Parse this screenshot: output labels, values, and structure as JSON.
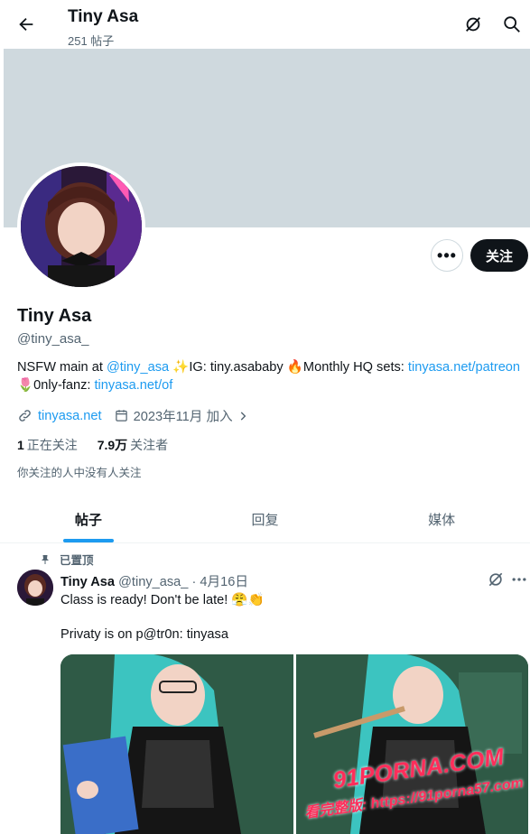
{
  "header": {
    "title": "Tiny Asa",
    "post_count": "251 帖子"
  },
  "profile": {
    "more_label": "•••",
    "follow_label": "关注",
    "name": "Tiny Asa",
    "handle": "@tiny_asa_",
    "bio": {
      "p1": "NSFW main at ",
      "mention": "@tiny_asa",
      "p2": " ✨IG: tiny.asababy 🔥Monthly HQ sets: ",
      "link1": "tinyasa.net/patreon",
      "p3": "🌷0nly-fanz: ",
      "link2": "tinyasa.net/of"
    },
    "website": "tinyasa.net",
    "joined": "2023年11月 加入",
    "following_count": "1",
    "following_label": "正在关注",
    "followers_count": "7.9万",
    "followers_label": "关注者",
    "mutual_note": "你关注的人中没有人关注"
  },
  "tabs": [
    {
      "label": "帖子",
      "active": true
    },
    {
      "label": "回复",
      "active": false
    },
    {
      "label": "媒体",
      "active": false
    }
  ],
  "tweet": {
    "pinned_label": "已置顶",
    "author": "Tiny Asa",
    "handle": "@tiny_asa_",
    "sep": "·",
    "date": "4月16日",
    "line1": "Class is ready! Don't be late! 😤👏",
    "line2": "Privaty is on p@tr0n: tinyasa"
  },
  "watermark": {
    "line1": "91PORNA.COM",
    "line2": "看完整版: https://91porna57.com"
  },
  "colors": {
    "accent": "#1d9bf0",
    "banner": "#cfd9de",
    "follow_bg": "#0f1419"
  }
}
